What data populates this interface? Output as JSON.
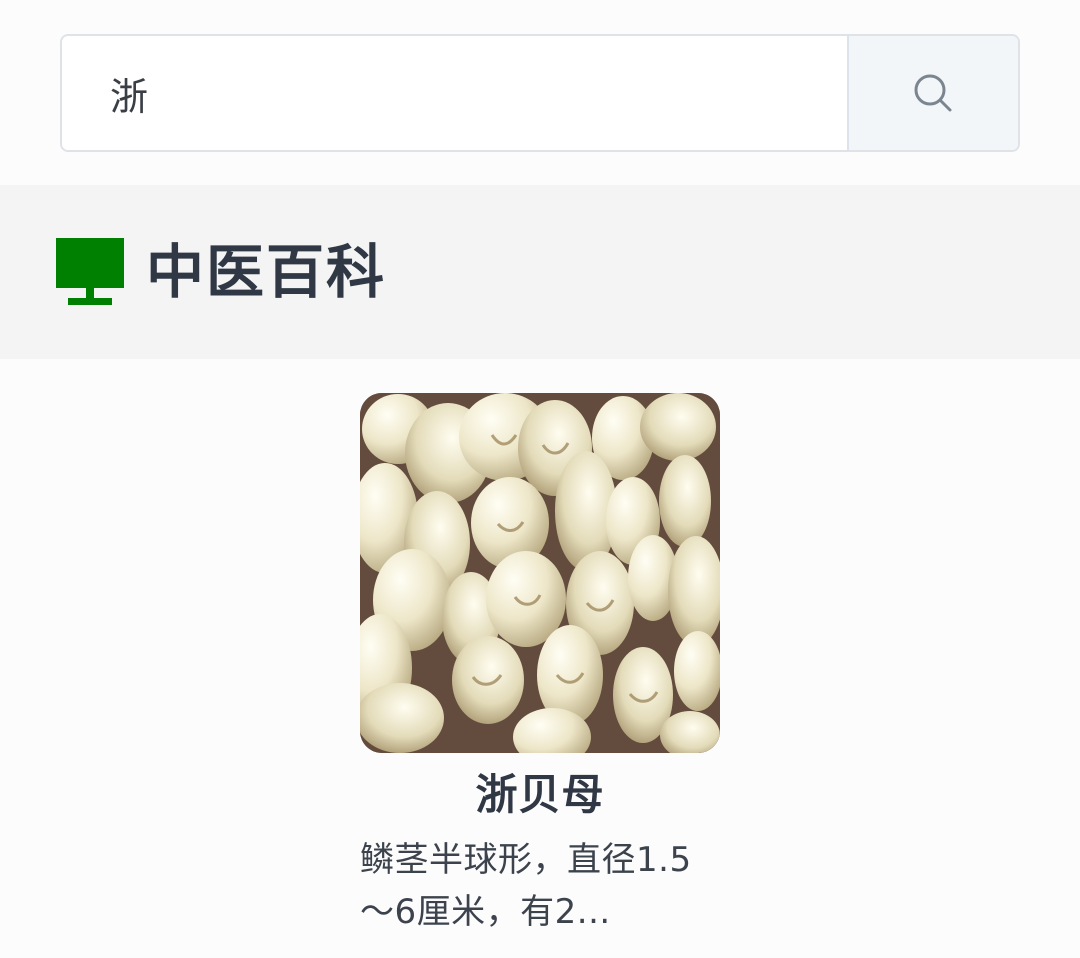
{
  "search": {
    "value": "浙",
    "placeholder": ""
  },
  "icons": {
    "search": "search-icon",
    "section": "monitor-icon",
    "card_image": "fritillaria-bulbs-image"
  },
  "colors": {
    "section_icon": "#008000",
    "section_band": "#f4f4f5",
    "search_button": "#f2f6f9"
  },
  "section": {
    "title": "中医百科"
  },
  "results": [
    {
      "title": "浙贝母",
      "description": "鳞茎半球形，直径1.5～6厘米，有2..."
    }
  ]
}
